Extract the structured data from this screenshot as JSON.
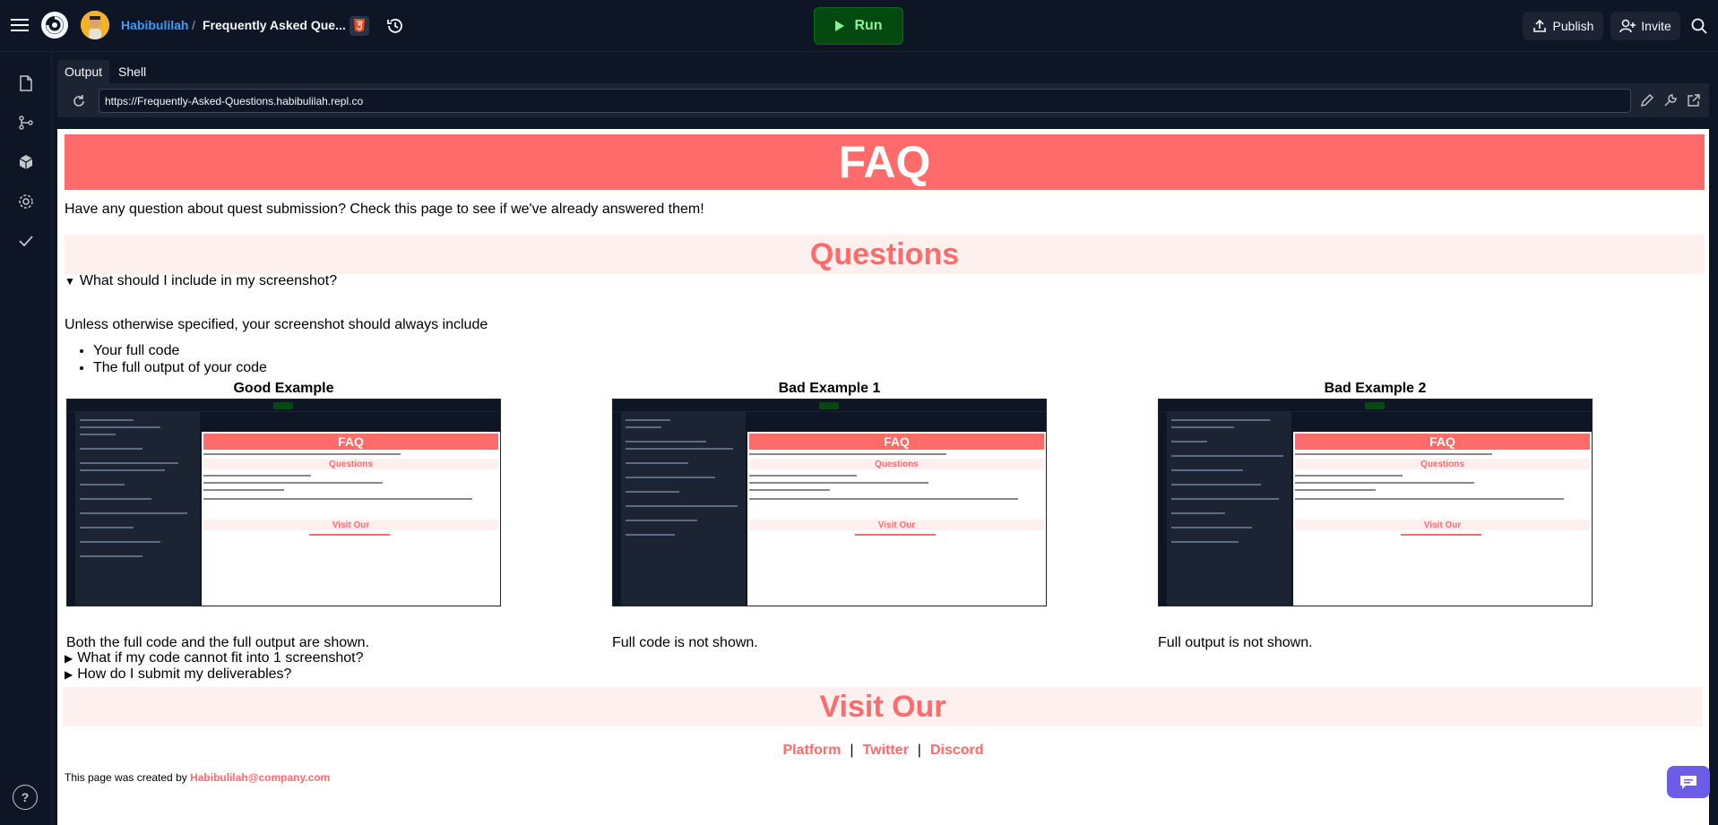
{
  "header": {
    "username": "Habibulilah",
    "separator": "/",
    "repl_name": "Frequently Asked Que...",
    "run_label": "Run",
    "publish_label": "Publish",
    "invite_label": "Invite"
  },
  "panel": {
    "tabs": [
      {
        "label": "Output",
        "active": true
      },
      {
        "label": "Shell",
        "active": false
      }
    ],
    "url": "https://Frequently-Asked-Questions.habibulilah.repl.co"
  },
  "page": {
    "title": "FAQ",
    "intro": "Have any question about quest submission? Check this page to see if we've already answered them!",
    "questions_heading": "Questions",
    "q1": {
      "question": "What should I include in my screenshot?",
      "expanded": true,
      "answer": "Unless otherwise specified, your screenshot should always include",
      "items": [
        "Your full code",
        "The full output of your code"
      ],
      "examples": [
        {
          "title": "Good Example",
          "caption": "Both the full code and the full output are shown."
        },
        {
          "title": "Bad Example 1",
          "caption": "Full code is not shown."
        },
        {
          "title": "Bad Example 2",
          "caption": "Full output is not shown."
        }
      ]
    },
    "q2": {
      "question": "What if my code cannot fit into 1 screenshot?",
      "expanded": false
    },
    "q3": {
      "question": "How do I submit my deliverables?",
      "expanded": false
    },
    "visit_heading": "Visit Our",
    "links": [
      "Platform",
      "Twitter",
      "Discord"
    ],
    "footer_prefix": "This page was created by ",
    "footer_email": "Habibulilah@company.com"
  },
  "colors": {
    "accent": "#ff6b6b",
    "band": "#fff0f0",
    "link_user": "#3d9cf5",
    "run_bg": "#044a10",
    "run_text": "#8cf09a"
  }
}
